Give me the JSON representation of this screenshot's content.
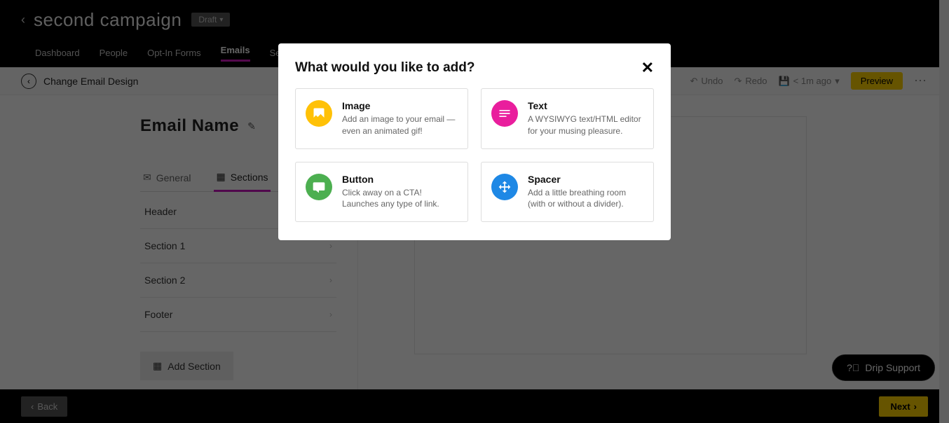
{
  "header": {
    "campaign_title": "second campaign",
    "draft_label": "Draft"
  },
  "nav": {
    "tabs": [
      "Dashboard",
      "People",
      "Opt-In Forms",
      "Emails",
      "Settings"
    ],
    "active_index": 3
  },
  "toolbar": {
    "change_design": "Change Email Design",
    "undo": "Undo",
    "redo": "Redo",
    "saved": "< 1m ago",
    "preview": "Preview"
  },
  "editor": {
    "email_name": "Email Name",
    "panel_tabs": {
      "general": "General",
      "sections": "Sections"
    },
    "sections": [
      {
        "label": "Header",
        "toggle": "OFF"
      },
      {
        "label": "Section 1"
      },
      {
        "label": "Section 2"
      },
      {
        "label": "Footer"
      }
    ],
    "add_section": "Add Section"
  },
  "bottom": {
    "back": "Back",
    "next": "Next"
  },
  "support": {
    "label": "Drip Support"
  },
  "modal": {
    "title": "What would you like to add?",
    "options": [
      {
        "title": "Image",
        "desc": "Add an image to your email — even an animated gif!"
      },
      {
        "title": "Text",
        "desc": "A WYSIWYG text/HTML editor for your musing pleasure."
      },
      {
        "title": "Button",
        "desc": "Click away on a CTA! Launches any type of link."
      },
      {
        "title": "Spacer",
        "desc": "Add a little breathing room (with or without a divider)."
      }
    ]
  }
}
